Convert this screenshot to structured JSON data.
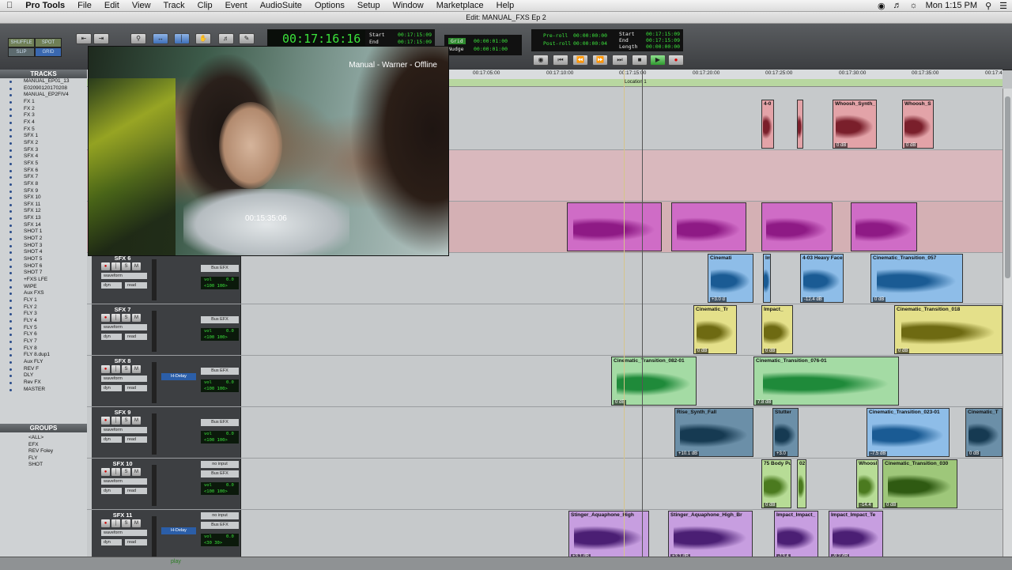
{
  "menubar": {
    "items": [
      "Pro Tools",
      "File",
      "Edit",
      "View",
      "Track",
      "Clip",
      "Event",
      "AudioSuite",
      "Options",
      "Setup",
      "Window",
      "Marketplace",
      "Help"
    ],
    "clock": "Mon 1:15 PM"
  },
  "window": {
    "title": "Edit: MANUAL_FXS Ep 2"
  },
  "toolbar": {
    "modes": [
      "SHUFFLE",
      "SPOT",
      "SLIP",
      "GRID"
    ],
    "main_counter": "00:17:16:16",
    "start_label": "Start",
    "start_value": "00:17:15:09",
    "end_label": "End",
    "end_value": "00:17:15:09",
    "grid_label": "Grid",
    "grid_value": "00:00:01:00",
    "nudge_label": "Nudge",
    "nudge_value": "00:00:01:00",
    "preroll_label": "Pre-roll",
    "preroll_value": "00:00:00:00",
    "postroll_label": "Post-roll",
    "postroll_value": "00:00:00:04",
    "sel_start_label": "Start",
    "sel_start_value": "00:17:15:09",
    "sel_end_label": "End",
    "sel_end_value": "00:17:15:09",
    "length_label": "Length",
    "length_value": "00:00:00:00"
  },
  "tracks_panel": {
    "header": "TRACKS",
    "items": [
      "MANUAL_EP01_13",
      "E02090120170208",
      "MANUAL_EP2FIV4",
      "FX 1",
      "FX 2",
      "FX 3",
      "FX 4",
      "FX 5",
      "SFX 1",
      "SFX 2",
      "SFX 3",
      "SFX 4",
      "SFX 5",
      "SFX 6",
      "SFX 7",
      "SFX 8",
      "SFX 9",
      "SFX 10",
      "SFX 11",
      "SFX 12",
      "SFX 13",
      "SFX 14",
      "SHOT 1",
      "SHOT 2",
      "SHOT 3",
      "SHOT 4",
      "SHOT 5",
      "SHOT 6",
      "SHOT 7",
      "+FXS LFE",
      "WIPE",
      "Aux FXS",
      "FLY 1",
      "FLY 2",
      "FLY 3",
      "FLY 4",
      "FLY 5",
      "FLY 6",
      "FLY 7",
      "FLY 8",
      "FLY 8.dup1",
      "Aux FLY",
      "REV F",
      "DLY",
      "Rev FX",
      "MASTER"
    ]
  },
  "groups_panel": {
    "header": "GROUPS",
    "items": [
      "<ALL>",
      "EFX",
      "REV Foley",
      "FLY",
      "SHOT"
    ]
  },
  "ruler": {
    "ticks": [
      "00:17:05:00",
      "00:17:10:00",
      "00:17:15:00",
      "00:17:20:00",
      "00:17:25:00",
      "00:17:30:00",
      "00:17:35:00",
      "00:17:4"
    ],
    "marker": "Location 1"
  },
  "video": {
    "title": "Manual - Warner - Offline",
    "timecode": "00:15:35:06"
  },
  "track_strings": {
    "waveform": "waveform",
    "dyn": "dyn",
    "read": "read",
    "vol": "vol",
    "bus": "Bus EFX",
    "noinput": "no input",
    "hdelay": "H-Delay",
    "s": "S",
    "m": "M"
  },
  "lanes": [
    {
      "name": "SFX 6",
      "vol": "0.0",
      "pan": "<100  100>",
      "top_io": "",
      "insert": ""
    },
    {
      "name": "SFX 7",
      "vol": "0.0",
      "pan": "<100  100>",
      "top_io": "",
      "insert": ""
    },
    {
      "name": "SFX 8",
      "vol": "0.0",
      "pan": "<100  100>",
      "top_io": "",
      "insert": "H-Delay"
    },
    {
      "name": "SFX 9",
      "vol": "0.0",
      "pan": "<100  100>",
      "top_io": "",
      "insert": ""
    },
    {
      "name": "SFX 10",
      "vol": "0.0",
      "pan": "<100  100>",
      "top_io": "no input",
      "insert": ""
    },
    {
      "name": "SFX 11",
      "vol": "0.0",
      "pan": "<30  30>",
      "top_io": "no input",
      "insert": "H-Delay"
    }
  ],
  "clips": {
    "top1": [
      {
        "name": "4-0",
        "gain": "",
        "color": "#e3a3a8",
        "wave": "#7a1f2b"
      },
      {
        "name": "",
        "gain": "",
        "color": "#e3a3a8",
        "wave": "#7a1f2b"
      },
      {
        "name": "Whoosh_Synth_",
        "gain": "0 dB",
        "color": "#e3a3a8",
        "wave": "#7a1f2b"
      },
      {
        "name": "Whoosh_S",
        "gain": "0 dB",
        "color": "#e3a3a8",
        "wave": "#7a1f2b"
      }
    ],
    "top3": [
      {
        "name": "",
        "gain": "",
        "color": "#cf6cc6",
        "wave": "#8e1a85"
      },
      {
        "name": "",
        "gain": "",
        "color": "#cf6cc6",
        "wave": "#8e1a85"
      },
      {
        "name": "",
        "gain": "",
        "color": "#cf6cc6",
        "wave": "#8e1a85"
      },
      {
        "name": "",
        "gain": "",
        "color": "#cf6cc6",
        "wave": "#8e1a85"
      }
    ],
    "sfx6": [
      {
        "name": "Cinemati",
        "gain": "+3.0 d",
        "color": "#8ebde8",
        "wave": "#1a5b94"
      },
      {
        "name": "Im",
        "gain": "",
        "color": "#8ebde8",
        "wave": "#1a5b94"
      },
      {
        "name": "4-03 Heavy Face",
        "gain": "-12.4 dB",
        "color": "#8ebde8",
        "wave": "#1a5b94"
      },
      {
        "name": "Cinematic_Transition_057",
        "gain": "0 dB",
        "color": "#8ebde8",
        "wave": "#1a5b94"
      }
    ],
    "sfx7": [
      {
        "name": "Cinematic_Tr",
        "gain": "0 dB",
        "color": "#e4e08a",
        "wave": "#6e6a12"
      },
      {
        "name": "Impact_",
        "gain": "0 dB",
        "color": "#e4e08a",
        "wave": "#6e6a12"
      },
      {
        "name": "Cinematic_Transition_018",
        "gain": "0 dB",
        "color": "#e4e08a",
        "wave": "#6e6a12"
      }
    ],
    "sfx8": [
      {
        "name": "Cinematic_Transition_082-01",
        "gain": "0 dB",
        "color": "#a4dba4",
        "wave": "#1f8a3a"
      },
      {
        "name": "Cinematic_Transition_076-01",
        "gain": "7.8 dB",
        "color": "#a4dba4",
        "wave": "#1f8a3a"
      }
    ],
    "sfx9": [
      {
        "name": "Rise_Synth_Fall",
        "gain": "+10.1 dB",
        "color": "#6b8fa8",
        "wave": "#163a52"
      },
      {
        "name": "Stutter",
        "gain": "+3.0",
        "color": "#6b8fa8",
        "wave": "#163a52"
      },
      {
        "name": "Cinematic_Transition_023-01",
        "gain": "-7.5 dB",
        "color": "#8ebde8",
        "wave": "#1a5b94"
      },
      {
        "name": "Cinematic_T",
        "gain": "0 dB",
        "color": "#6b8fa8",
        "wave": "#163a52"
      }
    ],
    "sfx10": [
      {
        "name": "75 Body Pu",
        "gain": "0 dB",
        "color": "#b7dc96",
        "wave": "#4b7a1f"
      },
      {
        "name": "02",
        "gain": "",
        "color": "#b7dc96",
        "wave": "#4b7a1f"
      },
      {
        "name": "Whoosl",
        "gain": "-14.4",
        "color": "#b7dc96",
        "wave": "#4b7a1f"
      },
      {
        "name": "Cinematic_Transition_030",
        "gain": "0 dB",
        "color": "#9ec77a",
        "wave": "#2f5a12"
      }
    ],
    "sfx11": [
      {
        "name": "Stinger_Aquaphone_High",
        "gain": "+3.1 dB",
        "color": "#c79ee0",
        "wave": "#4b1f74"
      },
      {
        "name": "Stinger_Aquaphone_High_Br",
        "gain": "+3.1 dB",
        "color": "#c79ee0",
        "wave": "#4b1f74"
      },
      {
        "name": "Impact_Impact_",
        "gain": "-13.4",
        "color": "#c79ee0",
        "wave": "#4b1f74"
      },
      {
        "name": "Impact_Impact_Te",
        "gain": "-9.2 dB",
        "color": "#c79ee0",
        "wave": "#4b1f74"
      }
    ]
  },
  "status": {
    "play_label": "play"
  }
}
